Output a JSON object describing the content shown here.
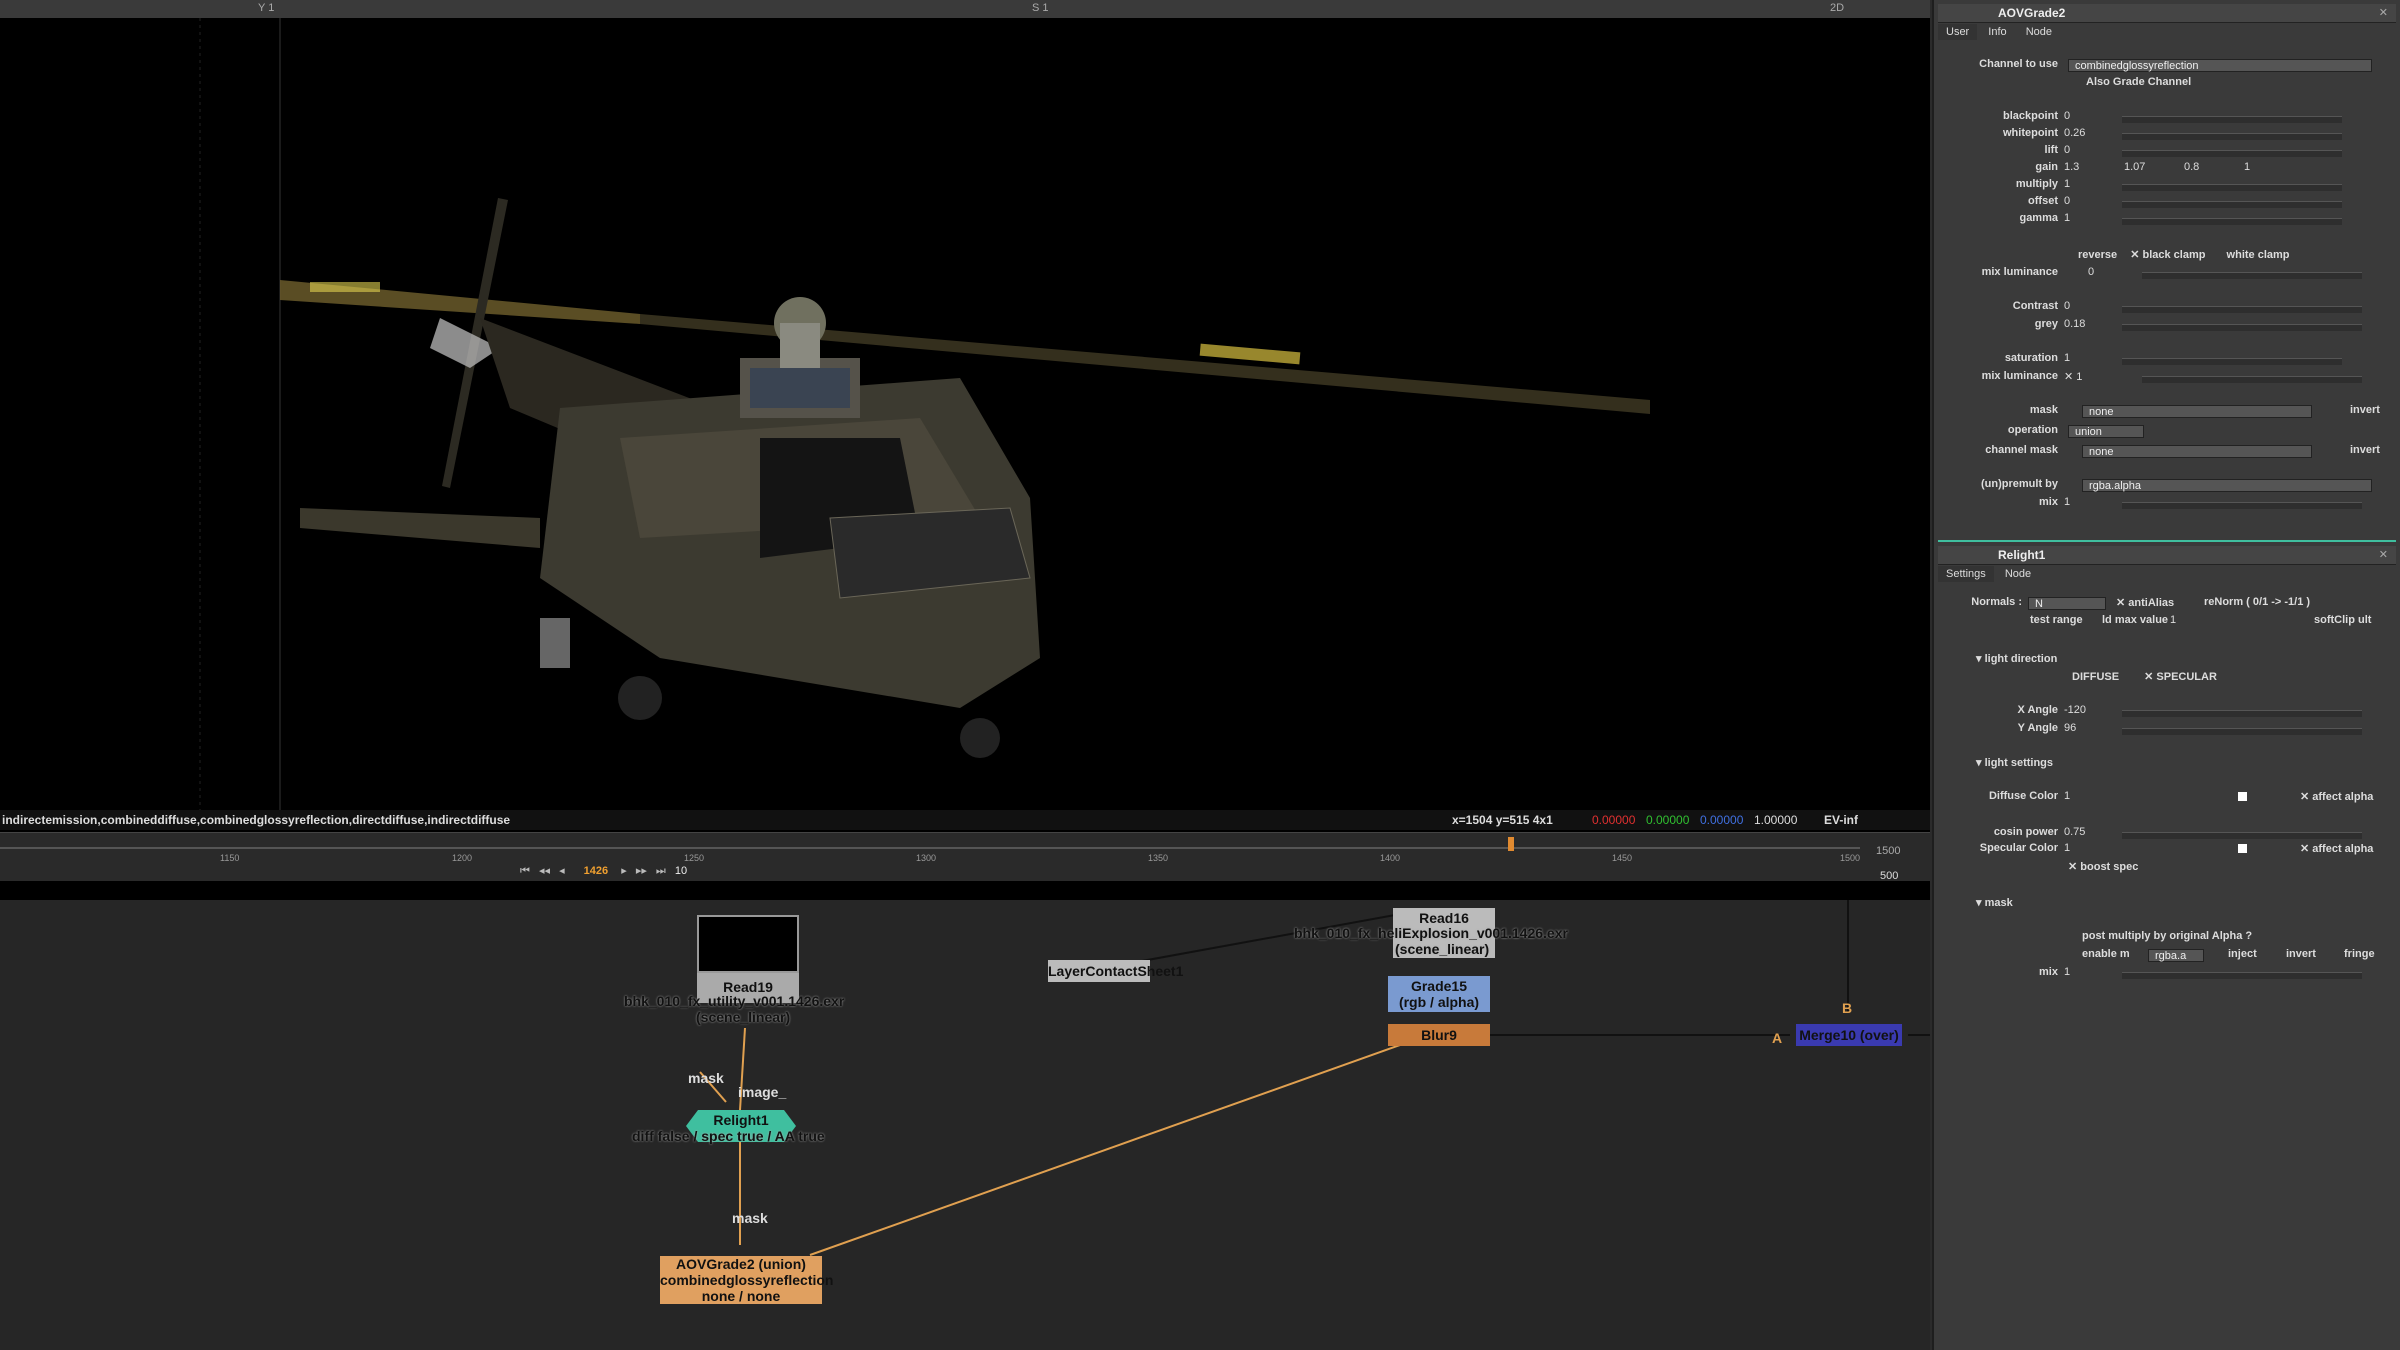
{
  "viewer": {
    "top_left_label": "Y 1",
    "mid_label": "S 1",
    "mode_label": "2D",
    "layers_text": "indirectemission,combineddiffuse,combinedglossyreflection,directdiffuse,indirectdiffuse",
    "pixel_coord": "x=1504 y=515 4x1",
    "pixel_r": "0.00000",
    "pixel_g": "0.00000",
    "pixel_b": "0.00000",
    "pixel_a": "1.00000",
    "ev": "EV-inf"
  },
  "timeline": {
    "ticks": [
      "1150",
      "1200",
      "1250",
      "1300",
      "1350",
      "1400",
      "1450",
      "1500"
    ],
    "end_frame": "1500",
    "current_frame": "1426",
    "step": "10",
    "end_small": "500"
  },
  "nodes": {
    "read19_title": "Read19",
    "read19_file": "bhk_010_fx_utility_v001.1426.exr",
    "read19_space": "(scene_linear)",
    "read16_title": "Read16",
    "read16_file": "bhk_010_fx_heliExplosion_v001.1426.exr",
    "read16_space": "(scene_linear)",
    "contact_sheet": "LayerContactSheet1",
    "grade15_line1": "Grade15",
    "grade15_line2": "(rgb / alpha)",
    "blur9": "Blur9",
    "merge10": "Merge10 (over)",
    "relight1_title": "Relight1",
    "relight1_sub": "diff false / spec true / AA true",
    "aov_line1": "AOVGrade2 (union)",
    "aov_line2": "combinedglossyreflection",
    "aov_line3": "none / none",
    "edge_mask1": "mask",
    "edge_image": "image_",
    "edge_mask2": "mask",
    "edge_b": "B",
    "edge_a": "A"
  },
  "aovgrade": {
    "title": "AOVGrade2",
    "tabs": [
      "User",
      "Info",
      "Node"
    ],
    "channel_label": "Channel to use",
    "channel_value": "combinedglossyreflection",
    "also_grade": "Also Grade Channel",
    "rows": [
      {
        "k": "blackpoint",
        "v": "0"
      },
      {
        "k": "whitepoint",
        "v": "0.26"
      },
      {
        "k": "lift",
        "v": "0"
      },
      {
        "k": "gain",
        "v": "1.3"
      },
      {
        "k": "multiply",
        "v": "1"
      },
      {
        "k": "offset",
        "v": "0"
      },
      {
        "k": "gamma",
        "v": "1"
      }
    ],
    "gain_extra": [
      "1.07",
      "0.8",
      "1"
    ],
    "reverse": "reverse",
    "black_clamp": "black clamp",
    "white_clamp": "white clamp",
    "mix_lum_label": "mix luminance",
    "mix_lum_value": "0",
    "contrast_label": "Contrast",
    "contrast_value": "0",
    "grey_label": "grey",
    "grey_value": "0.18",
    "saturation_label": "saturation",
    "saturation_value": "1",
    "mix_lum2_label": "mix luminance",
    "mix_lum2_value": "1",
    "mask_label": "mask",
    "mask_value": "none",
    "invert": "invert",
    "operation_label": "operation",
    "operation_value": "union",
    "channel_mask_label": "channel mask",
    "channel_mask_value": "none",
    "premult_label": "(un)premult by",
    "premult_value": "rgba.alpha",
    "mix_label": "mix",
    "mix_value": "1"
  },
  "relight": {
    "title": "Relight1",
    "tabs": [
      "Settings",
      "Node"
    ],
    "normals_label": "Normals :",
    "normals_value": "N",
    "antialias": "antiAlias",
    "renorm": "reNorm ( 0/1 -> -1/1 )",
    "test_range": "test range",
    "ld_max": "ld max value",
    "ld_max_value": "1",
    "softclip": "softClip ult",
    "light_direction": "light direction",
    "diffuse": "DIFFUSE",
    "specular": "SPECULAR",
    "x_angle_label": "X Angle",
    "x_angle_value": "-120",
    "y_angle_label": "Y Angle",
    "y_angle_value": "96",
    "light_settings": "light settings",
    "diffuse_color_label": "Diffuse Color",
    "diffuse_color_value": "1",
    "affect_alpha": "affect alpha",
    "cosin_label": "cosin power",
    "cosin_value": "0.75",
    "spec_color_label": "Specular Color",
    "spec_color_value": "1",
    "affect_alpha2": "affect alpha",
    "boost_spec": "boost spec",
    "mask_section": "mask",
    "post_multiply": "post multiply by original Alpha ?",
    "enable_m": "enable m",
    "rgba_a": "rgba.a",
    "inject": "inject",
    "invert": "invert",
    "fringe": "fringe",
    "mix_label": "mix",
    "mix_value": "1"
  },
  "colors": {
    "accent_green": "#3fbf9f",
    "node_orange": "#e0a060",
    "node_blue": "#7a9ad0",
    "merge_blue": "#3a3ab0"
  }
}
